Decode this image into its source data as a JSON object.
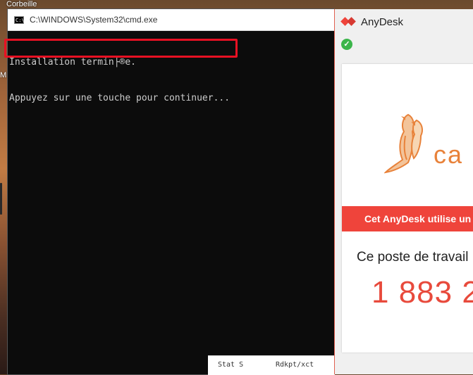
{
  "desktop": {
    "recycle_label": "Corbeille",
    "mic_label": "Mic"
  },
  "cmd": {
    "title": "C:\\WINDOWS\\System32\\cmd.exe",
    "icon_text": "C:\\",
    "lines": [
      "Installation termin├®e.",
      "Appuyez sur une touche pour continuer..."
    ]
  },
  "bottom_strip": {
    "col1": "Stat S",
    "col2": "Rdkpt/xct"
  },
  "anydesk": {
    "title": "AnyDesk",
    "brand_text": "ca",
    "banner": "Cet AnyDesk utilise un",
    "workstation_label": "Ce poste de travail",
    "address": "1 883 2",
    "colors": {
      "accent": "#ef443b",
      "check": "#3bb54a",
      "brand": "#e8823a"
    }
  }
}
